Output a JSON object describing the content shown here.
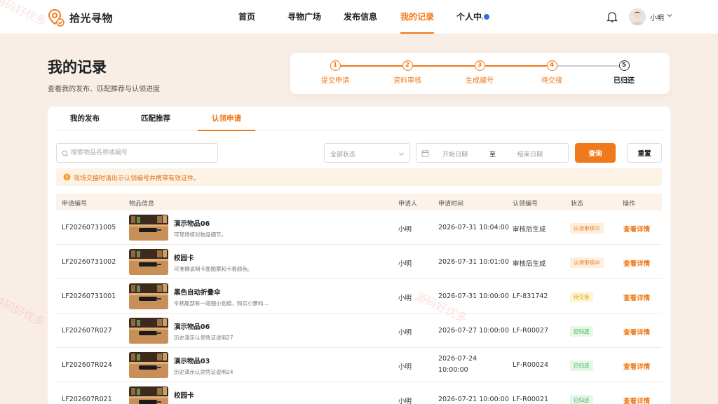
{
  "app": {
    "name": "拾光寻物",
    "brand_color": "#f07a1a"
  },
  "nav": {
    "items": [
      "首页",
      "寻物广场",
      "发布信息",
      "我的记录",
      "个人中心"
    ],
    "active_index": 3
  },
  "user": {
    "name": "小明"
  },
  "page": {
    "title": "我的记录",
    "subtitle": "查看我的发布、匹配推荐与认领进度"
  },
  "steps": [
    {
      "num": "1",
      "label": "提交申请"
    },
    {
      "num": "2",
      "label": "资料审核"
    },
    {
      "num": "3",
      "label": "生成编号"
    },
    {
      "num": "4",
      "label": "待交接"
    },
    {
      "num": "5",
      "label": "已归还"
    }
  ],
  "tabs": [
    "我的发布",
    "匹配推荐",
    "认领申请"
  ],
  "filters": {
    "search_placeholder": "搜索物品名称或编号",
    "status_placeholder": "全部状态",
    "date_start": "开始日期",
    "date_sep": "至",
    "date_end": "结束日期",
    "query_label": "查询",
    "reset_label": "重置"
  },
  "notice": "现场交接时请出示认领编号并携带有效证件。",
  "table": {
    "headers": [
      "申请编号",
      "物品信息",
      "申请人",
      "申请时间",
      "认领编号",
      "状态",
      "操作"
    ],
    "rows": [
      {
        "id": "LF20260731005",
        "name": "演示物品06",
        "desc": "可现场核对物品细节。",
        "applicant": "小明",
        "time": "2026-07-31 10:04:00",
        "claim": "审核后生成",
        "status": "认领审核中",
        "status_type": "orange",
        "action": "查看详情"
      },
      {
        "id": "LF20260731002",
        "name": "校园卡",
        "desc": "可准确说明卡面图案和卡套颜色。",
        "applicant": "小明",
        "time": "2026-07-31 10:01:00",
        "claim": "审核后生成",
        "status": "认领审核中",
        "status_type": "orange",
        "action": "查看详情"
      },
      {
        "id": "LF20260731001",
        "name": "黑色自动折叠伞",
        "desc": "伞柄尾部有一道细小划痕，购买小票和...",
        "applicant": "小明",
        "time": "2026-07-31 10:00:00",
        "claim": "LF-831742",
        "status": "待交接",
        "status_type": "yellow",
        "action": "查看详情"
      },
      {
        "id": "LF202607R027",
        "name": "演示物品06",
        "desc": "历史演示认领凭证说明27",
        "applicant": "小明",
        "time": "2026-07-27 10:00:00",
        "claim": "LF-R00027",
        "status": "已归还",
        "status_type": "green",
        "action": "查看详情"
      },
      {
        "id": "LF202607R024",
        "name": "演示物品03",
        "desc": "历史演示认领凭证说明24",
        "applicant": "小明",
        "time": "2026-07-24 10:00:00",
        "time_line1": "2026-07-24",
        "time_line2": "10:00:00",
        "claim": "LF-R00024",
        "status": "已归还",
        "status_type": "green",
        "action": "查看详情"
      },
      {
        "id": "LF202607R021",
        "name": "校园卡",
        "desc": "",
        "applicant": "小明",
        "time": "2026-07-21 10:00:00",
        "claim": "LF-R00021",
        "status": "已归还",
        "status_type": "green",
        "action": "查看详情"
      }
    ]
  },
  "watermark": "源码好优多"
}
